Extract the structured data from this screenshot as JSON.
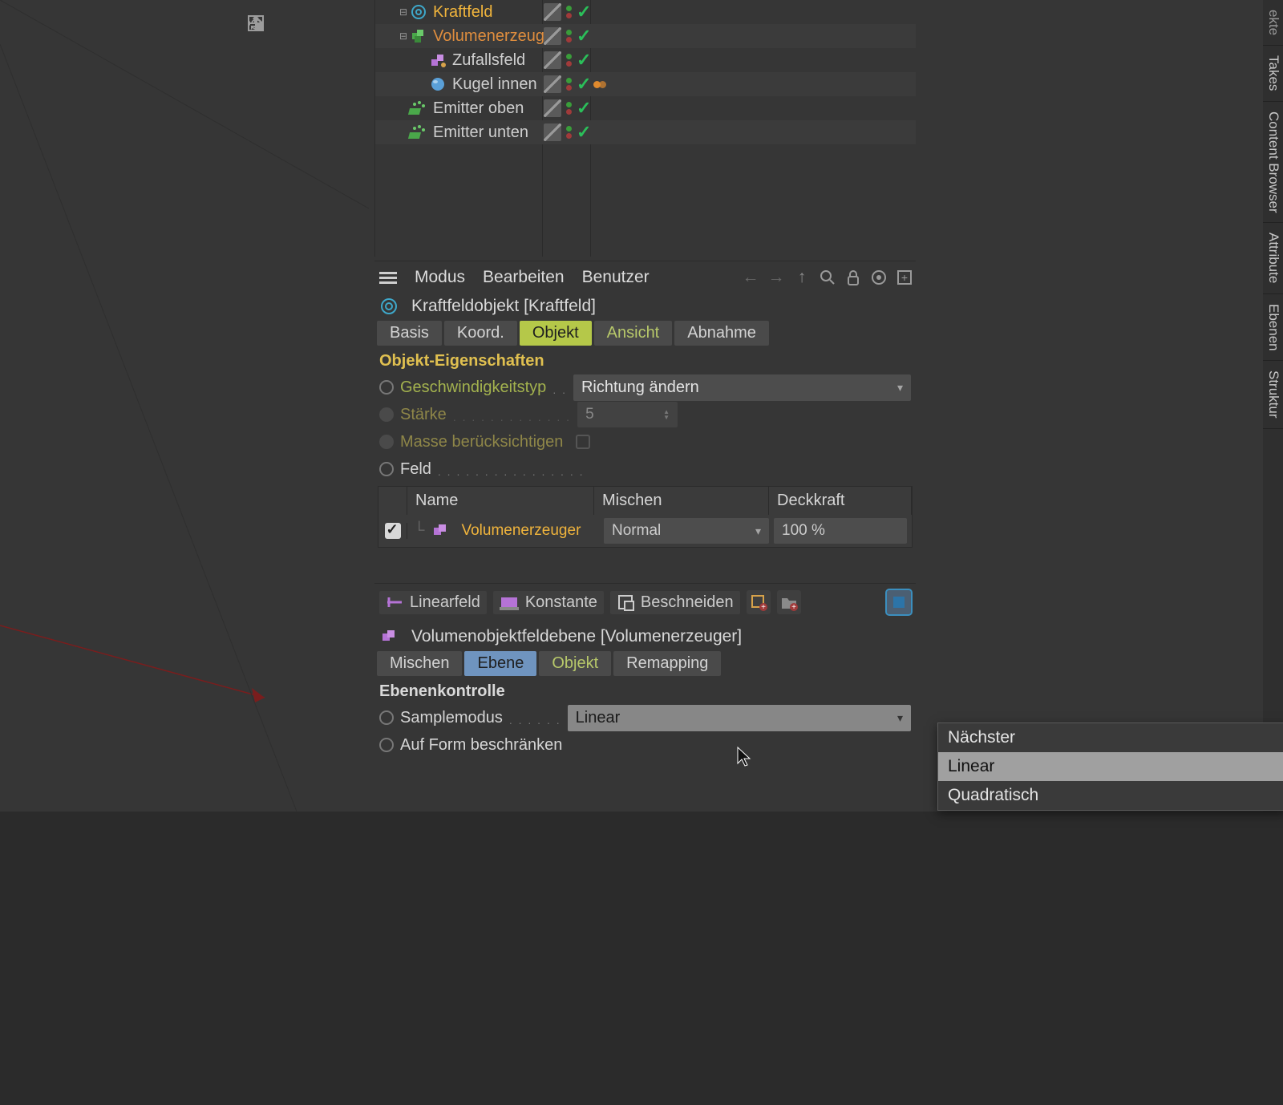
{
  "viewport_tools": [
    "move",
    "down",
    "rotate",
    "frame"
  ],
  "objects": [
    {
      "label": "Kraftfeld",
      "icon": "force-field",
      "sel": "selected",
      "indent": 24,
      "alt": false,
      "expander": "minus"
    },
    {
      "label": "Volumenerzeuger",
      "icon": "volume-gen",
      "sel": "hot",
      "indent": 24,
      "alt": true,
      "expander": "minus"
    },
    {
      "label": "Zufallsfeld",
      "icon": "random-field",
      "sel": "",
      "indent": 48,
      "alt": false,
      "expander": ""
    },
    {
      "label": "Kugel innen",
      "icon": "sphere",
      "sel": "",
      "indent": 48,
      "alt": true,
      "expander": "",
      "orange_tag": true
    },
    {
      "label": "Emitter oben",
      "icon": "emitter",
      "sel": "",
      "indent": 24,
      "alt": false,
      "expander": ""
    },
    {
      "label": "Emitter unten",
      "icon": "emitter",
      "sel": "",
      "indent": 24,
      "alt": true,
      "expander": ""
    }
  ],
  "attr_menu": {
    "mode": "Modus",
    "edit": "Bearbeiten",
    "user": "Benutzer"
  },
  "attr_header": {
    "title": "Kraftfeldobjekt [Kraftfeld]"
  },
  "tabs1": {
    "basis": "Basis",
    "koord": "Koord.",
    "objekt": "Objekt",
    "ansicht": "Ansicht",
    "abnahme": "Abnahme"
  },
  "props_title": "Objekt-Eigenschaften",
  "props": {
    "speed_type_label": "Geschwindigkeitstyp",
    "speed_type_value": "Richtung ändern",
    "strength_label": "Stärke",
    "strength_value": "5",
    "mass_label": "Masse berücksichtigen",
    "field_label": "Feld"
  },
  "field_table": {
    "head_name": "Name",
    "head_mix": "Mischen",
    "head_opacity": "Deckkraft",
    "row_name": "Volumenerzeuger",
    "row_mix": "Normal",
    "row_opacity": "100 %"
  },
  "field_toolbar": {
    "linear": "Linearfeld",
    "konst": "Konstante",
    "clip": "Beschneiden"
  },
  "sub_header": {
    "title": "Volumenobjektfeldebene [Volumenerzeuger]"
  },
  "tabs2": {
    "mischen": "Mischen",
    "ebene": "Ebene",
    "objekt": "Objekt",
    "remap": "Remapping"
  },
  "section2_title": "Ebenenkontrolle",
  "section2": {
    "sample_label": "Samplemodus",
    "sample_value": "Linear",
    "clamp_label": "Auf Form beschränken",
    "dd_items": [
      "Nächster",
      "Linear",
      "Quadratisch"
    ],
    "dd_hover_index": 1
  },
  "side_tabs": [
    "ekte",
    "Takes",
    "Content Browser",
    "Attribute",
    "Ebenen",
    "Struktur"
  ]
}
